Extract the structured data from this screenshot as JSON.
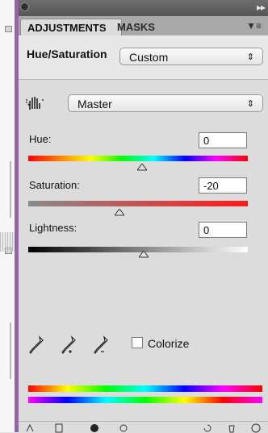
{
  "tabs": {
    "adjustments": "ADJUSTMENTS",
    "masks": "MASKS"
  },
  "header": {
    "title": "Hue/Saturation",
    "preset": "Custom"
  },
  "channel": "Master",
  "hue": {
    "label": "Hue:",
    "value": "0"
  },
  "saturation": {
    "label": "Saturation:",
    "value": "-20"
  },
  "lightness": {
    "label": "Lightness:",
    "value": "0"
  },
  "colorize": {
    "label": "Colorize",
    "checked": false
  },
  "icons": [
    "on-image-adjust-icon",
    "eyedropper-icon",
    "eyedropper-add-icon",
    "eyedropper-subtract-icon",
    "panel-menu-icon"
  ]
}
